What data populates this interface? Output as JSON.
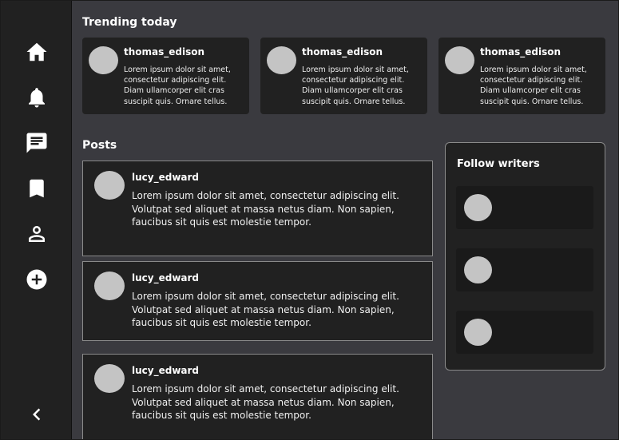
{
  "sidebar": {
    "items": [
      {
        "icon": "home-icon"
      },
      {
        "icon": "bell-icon"
      },
      {
        "icon": "message-icon"
      },
      {
        "icon": "bookmark-icon"
      },
      {
        "icon": "profile-icon"
      },
      {
        "icon": "add-icon"
      }
    ],
    "collapse_icon": "chevron-left-icon"
  },
  "trending": {
    "title": "Trending today",
    "cards": [
      {
        "username": "thomas_edison",
        "text": "Lorem ipsum dolor sit amet, consectetur adipiscing elit. Diam ullamcorper elit cras suscipit quis. Ornare tellus."
      },
      {
        "username": "thomas_edison",
        "text": "Lorem ipsum dolor sit amet, consectetur adipiscing elit. Diam ullamcorper elit cras suscipit quis. Ornare tellus."
      },
      {
        "username": "thomas_edison",
        "text": "Lorem ipsum dolor sit amet, consectetur adipiscing elit. Diam ullamcorper elit cras suscipit quis. Ornare tellus."
      }
    ]
  },
  "posts": {
    "title": "Posts",
    "items": [
      {
        "username": "lucy_edward",
        "text": "Lorem ipsum dolor sit amet, consectetur adipiscing elit. Volutpat sed aliquet at massa netus diam. Non sapien, faucibus sit quis est molestie tempor."
      },
      {
        "username": "lucy_edward",
        "text": "Lorem ipsum dolor sit amet, consectetur adipiscing elit. Volutpat sed aliquet at massa netus diam. Non sapien, faucibus sit quis est molestie tempor."
      },
      {
        "username": "lucy_edward",
        "text": "Lorem ipsum dolor sit amet, consectetur adipiscing elit. Volutpat sed aliquet at massa netus diam. Non sapien, faucibus sit quis est molestie tempor."
      }
    ]
  },
  "follow": {
    "title": "Follow writers",
    "writers": [
      {},
      {},
      {}
    ]
  },
  "colors": {
    "background": "#3a3a3f",
    "panel": "#212121",
    "avatar": "#c4c4c4",
    "text": "#ffffff"
  }
}
